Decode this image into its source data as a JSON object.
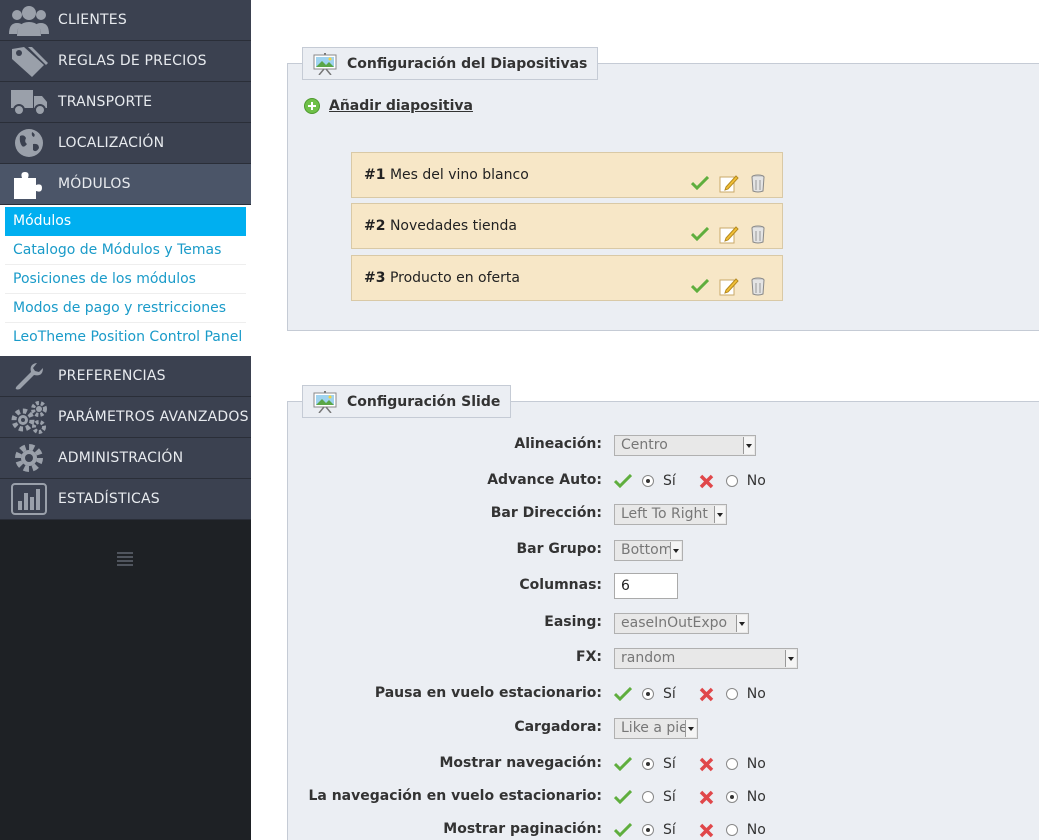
{
  "sidebar": {
    "items": [
      {
        "label": "CLIENTES",
        "icon": "users-icon"
      },
      {
        "label": "REGLAS DE PRECIOS",
        "icon": "tags-icon"
      },
      {
        "label": "TRANSPORTE",
        "icon": "truck-icon"
      },
      {
        "label": "LOCALIZACIÓN",
        "icon": "globe-icon"
      },
      {
        "label": "MÓDULOS",
        "icon": "puzzle-icon"
      },
      {
        "label": "PREFERENCIAS",
        "icon": "wrench-icon"
      },
      {
        "label": "PARÁMETROS AVANZADOS",
        "icon": "gears-icon"
      },
      {
        "label": "ADMINISTRACIÓN",
        "icon": "gear-icon"
      },
      {
        "label": "ESTADÍSTICAS",
        "icon": "bar-chart-icon"
      }
    ],
    "active_item": "MÓDULOS",
    "submenu": [
      "Módulos",
      "Catalogo de Módulos y Temas",
      "Posiciones de los módulos",
      "Modos de pago y restricciones",
      "LeoTheme Position Control Panel"
    ],
    "active_submenu": "Módulos"
  },
  "slides_panel": {
    "title": "Configuración del Diapositivas",
    "add_label": "Añadir diapositiva",
    "slides": [
      {
        "num": "#1",
        "name": "Mes del vino blanco"
      },
      {
        "num": "#2",
        "name": "Novedades tienda"
      },
      {
        "num": "#3",
        "name": "Producto en oferta"
      }
    ]
  },
  "config_panel": {
    "title": "Configuración Slide",
    "yes_label": "Sí",
    "no_label": "No",
    "fields": {
      "alineacion": {
        "label": "Alineación:",
        "value": "Centro"
      },
      "advance_auto": {
        "label": "Advance Auto:",
        "value": "Sí"
      },
      "bar_direccion": {
        "label": "Bar Dirección:",
        "value": "Left To Right"
      },
      "bar_grupo": {
        "label": "Bar Grupo:",
        "value": "Bottom"
      },
      "columnas": {
        "label": "Columnas:",
        "value": "6"
      },
      "easing": {
        "label": "Easing:",
        "value": "easeInOutExpo"
      },
      "fx": {
        "label": "FX:",
        "value": "random"
      },
      "pausa": {
        "label": "Pausa en vuelo estacionario:",
        "value": "Sí"
      },
      "cargadora": {
        "label": "Cargadora:",
        "value": "Like a pie"
      },
      "mostrar_nav": {
        "label": "Mostrar navegación:",
        "value": "Sí"
      },
      "nav_vuelo": {
        "label": "La navegación en vuelo estacionario:",
        "value": "No"
      },
      "mostrar_pag": {
        "label": "Mostrar paginación:",
        "value": "Sí"
      }
    }
  },
  "colors": {
    "sidebar_bg": "#3b4150",
    "sidebar_active": "#4b5568",
    "submenu_active": "#00aff0",
    "link": "#1a9bc9",
    "slide_row": "#f7e7c7",
    "panel_bg": "#ebeef3"
  }
}
